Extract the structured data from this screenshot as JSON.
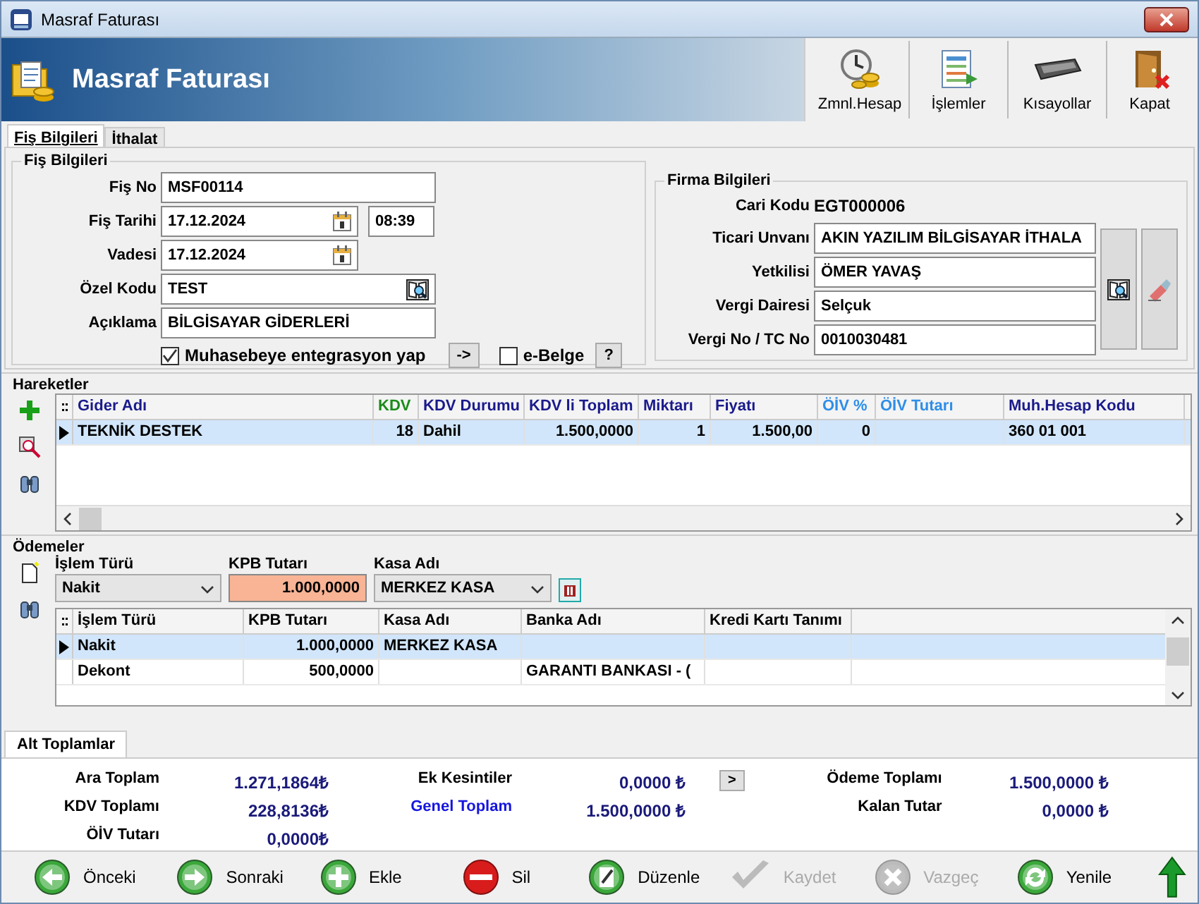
{
  "window": {
    "title": "Masraf Faturası"
  },
  "header": {
    "title": "Masraf Faturası",
    "toolbar": [
      {
        "label": "Zmnl.Hesap",
        "kind": "clock"
      },
      {
        "label": "İşlemler",
        "kind": "list"
      },
      {
        "label": "Kısayollar",
        "kind": "keyboard"
      },
      {
        "label": "Kapat",
        "kind": "door"
      }
    ]
  },
  "tabs": [
    {
      "label": "Fiş Bilgileri",
      "selected": true
    },
    {
      "label": "İthalat",
      "selected": false
    }
  ],
  "fis_bilgileri": {
    "title": "Fiş Bilgileri",
    "fis_no": {
      "label": "Fiş No",
      "value": "MSF00114"
    },
    "fis_tarihi": {
      "label": "Fiş Tarihi",
      "value": "17.12.2024",
      "time": "08:39"
    },
    "vadesi": {
      "label": "Vadesi",
      "value": "17.12.2024"
    },
    "ozel_kodu": {
      "label": "Özel Kodu",
      "value": "TEST"
    },
    "aciklama": {
      "label": "Açıklama",
      "value": "BİLGİSAYAR GİDERLERİ"
    },
    "muhasebe": {
      "label": "Muhasebeye entegrasyon yap",
      "checked": true
    },
    "arrow_button": "->",
    "e_belge": {
      "label": "e-Belge",
      "checked": false
    },
    "help_button": "?"
  },
  "firma_bilgileri": {
    "title": "Firma Bilgileri",
    "cari_kodu": {
      "label": "Cari Kodu",
      "value": "EGT000006"
    },
    "fields": [
      {
        "label": "Ticari Unvanı",
        "value": "AKIN YAZILIM BİLGİSAYAR İTHALA"
      },
      {
        "label": "Yetkilisi",
        "value": "ÖMER YAVAŞ"
      },
      {
        "label": "Vergi Dairesi",
        "value": "Selçuk"
      },
      {
        "label": "Vergi No / TC No",
        "value": "0010030481"
      }
    ]
  },
  "hareketler": {
    "title": "Hareketler",
    "columns": [
      {
        "label": "Gider Adı",
        "color": "#1a1a8c",
        "numeric": false
      },
      {
        "label": "KDV",
        "color": "#1a8c1a",
        "numeric": true
      },
      {
        "label": "KDV Durumu",
        "color": "#1a1a8c",
        "numeric": false
      },
      {
        "label": "KDV li Toplam",
        "color": "#1a1a8c",
        "numeric": true
      },
      {
        "label": "Miktarı",
        "color": "#1a1a8c",
        "numeric": true
      },
      {
        "label": "Fiyatı",
        "color": "#1a1a8c",
        "numeric": true
      },
      {
        "label": "ÖİV %",
        "color": "#2e8ee8",
        "numeric": true
      },
      {
        "label": "ÖİV Tutarı",
        "color": "#2e8ee8"
      },
      {
        "label": "Muh.Hesap Kodu",
        "color": "#1a1a8c",
        "numeric": false
      }
    ],
    "rows": [
      {
        "selected": true,
        "cells": [
          "TEKNİK DESTEK",
          "18",
          "Dahil",
          "1.500,0000",
          "1",
          "1.500,00",
          "0",
          "",
          "360 01 001"
        ]
      }
    ]
  },
  "odemeler": {
    "title": "Ödemeler",
    "islem_turu": {
      "label": "İşlem Türü",
      "value": "Nakit"
    },
    "kpb_tutari": {
      "label": "KPB Tutarı",
      "value": "1.000,0000"
    },
    "kasa_adi": {
      "label": "Kasa Adı",
      "value": "MERKEZ KASA"
    },
    "columns": [
      {
        "label": "İşlem Türü",
        "numeric": false
      },
      {
        "label": "KPB Tutarı",
        "numeric": true
      },
      {
        "label": "Kasa Adı",
        "numeric": false
      },
      {
        "label": "Banka Adı",
        "numeric": false
      },
      {
        "label": "Kredi Kartı Tanımı"
      }
    ],
    "rows": [
      {
        "selected": true,
        "cells": [
          "Nakit",
          "1.000,0000",
          "MERKEZ KASA",
          "",
          ""
        ]
      },
      {
        "selected": false,
        "cells": [
          "Dekont",
          "500,0000",
          "",
          "GARANTI BANKASI - (",
          ""
        ]
      }
    ]
  },
  "alt_toplamlar": {
    "tab": "Alt Toplamlar",
    "columns": [
      [
        {
          "label": "Ara Toplam",
          "value": "1.271,1864₺",
          "kind": "plain"
        },
        {
          "label": "KDV Toplamı",
          "value": "228,8136₺",
          "kind": "plain"
        },
        {
          "label": "ÖİV Tutarı",
          "value": "0,0000₺",
          "kind": "plain"
        }
      ],
      [
        {
          "label": "Ek Kesintiler",
          "value": "0,0000 ₺",
          "kind": "plain"
        },
        {
          "label": "Genel Toplam",
          "value": "1.500,0000 ₺",
          "kind": "link"
        }
      ],
      [
        {
          "label": "Ödeme Toplamı",
          "value": "1.500,0000 ₺",
          "kind": "plain"
        },
        {
          "label": "Kalan Tutar",
          "value": "0,0000 ₺",
          "kind": "plain"
        }
      ]
    ],
    "more_button": ">"
  },
  "buttons": [
    {
      "label": "Önceki",
      "kind": "prev",
      "disabled": false
    },
    {
      "label": "Sonraki",
      "kind": "next",
      "disabled": false
    },
    {
      "label": "Ekle",
      "kind": "add",
      "disabled": false
    },
    {
      "label": "Sil",
      "kind": "delete",
      "disabled": false
    },
    {
      "label": "Düzenle",
      "kind": "edit",
      "disabled": false
    },
    {
      "label": "Kaydet",
      "kind": "save",
      "disabled": true
    },
    {
      "label": "Vazgeç",
      "kind": "cancel",
      "disabled": true
    },
    {
      "label": "Yenile",
      "kind": "refresh",
      "disabled": false
    }
  ]
}
